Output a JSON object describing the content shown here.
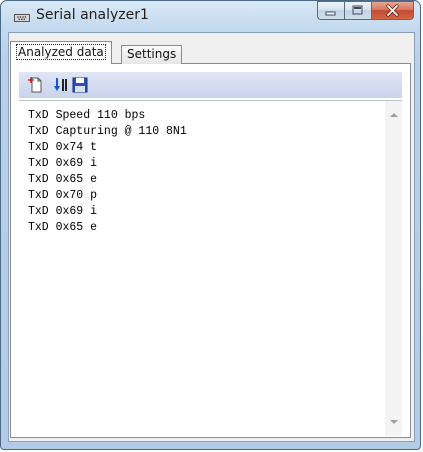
{
  "window": {
    "title": "Serial analyzer1",
    "controls": {
      "minimize": "minimize",
      "maximize": "maximize",
      "close": "close"
    }
  },
  "tabs": [
    {
      "label": "Analyzed data",
      "active": true
    },
    {
      "label": "Settings",
      "active": false
    }
  ],
  "toolbar": {
    "buttons": [
      {
        "icon": "new-document-icon"
      },
      {
        "icon": "pause-capture-icon"
      },
      {
        "icon": "save-disk-icon"
      }
    ]
  },
  "log": {
    "lines": [
      "TxD Speed 110 bps",
      "TxD Capturing @ 110 8N1",
      "TxD 0x74 t",
      "TxD 0x69 i",
      "TxD 0x65 e",
      "TxD 0x70 p",
      "TxD 0x69 i",
      "TxD 0x65 e"
    ]
  },
  "colors": {
    "accent": "#c9d3eb",
    "close": "#c24a2f",
    "frame": "#b8d0e8"
  }
}
